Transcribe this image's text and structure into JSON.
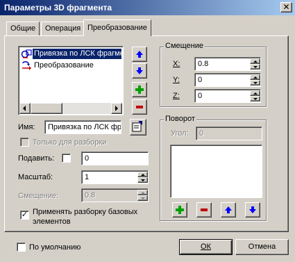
{
  "window": {
    "title": "Параметры 3D фрагмента",
    "close_glyph": "✕"
  },
  "tabs": [
    {
      "label": "Общие"
    },
    {
      "label": "Операция"
    },
    {
      "label": "Преобразование"
    }
  ],
  "tree": {
    "items": [
      {
        "label": "Привязка по ЛСК фрагмента",
        "selected": true
      },
      {
        "label": "Преобразование",
        "selected": false
      }
    ]
  },
  "name_field": {
    "label": "Имя:",
    "value": "Привязка по ЛСК фра"
  },
  "only_for_unpack": {
    "label": "Только для разборки"
  },
  "suppress": {
    "label": "Подавить:",
    "value": "0"
  },
  "scale": {
    "label": "Масштаб:",
    "value": "1"
  },
  "offset_field": {
    "label": "Смещение:",
    "value": "0.8"
  },
  "apply_unpack": {
    "label": "Применять разборку базовых элементов",
    "check": "✓"
  },
  "offset_group": {
    "title": "Смещение",
    "x": {
      "label": "X:",
      "value": "0.8"
    },
    "y": {
      "label": "Y:",
      "value": "0"
    },
    "z": {
      "label": "Z:",
      "value": "0"
    }
  },
  "rotation_group": {
    "title": "Поворот",
    "angle": {
      "label": "Угол:",
      "value": "0"
    }
  },
  "default_check": {
    "label": "По умолчанию"
  },
  "ok_button": {
    "label": "ОК"
  },
  "cancel_button": {
    "label": "Отмена"
  },
  "colors": {
    "accent_blue": "#0000ff",
    "add_green": "#00a000",
    "remove_red": "#c00000",
    "selection": "#0a246a"
  }
}
